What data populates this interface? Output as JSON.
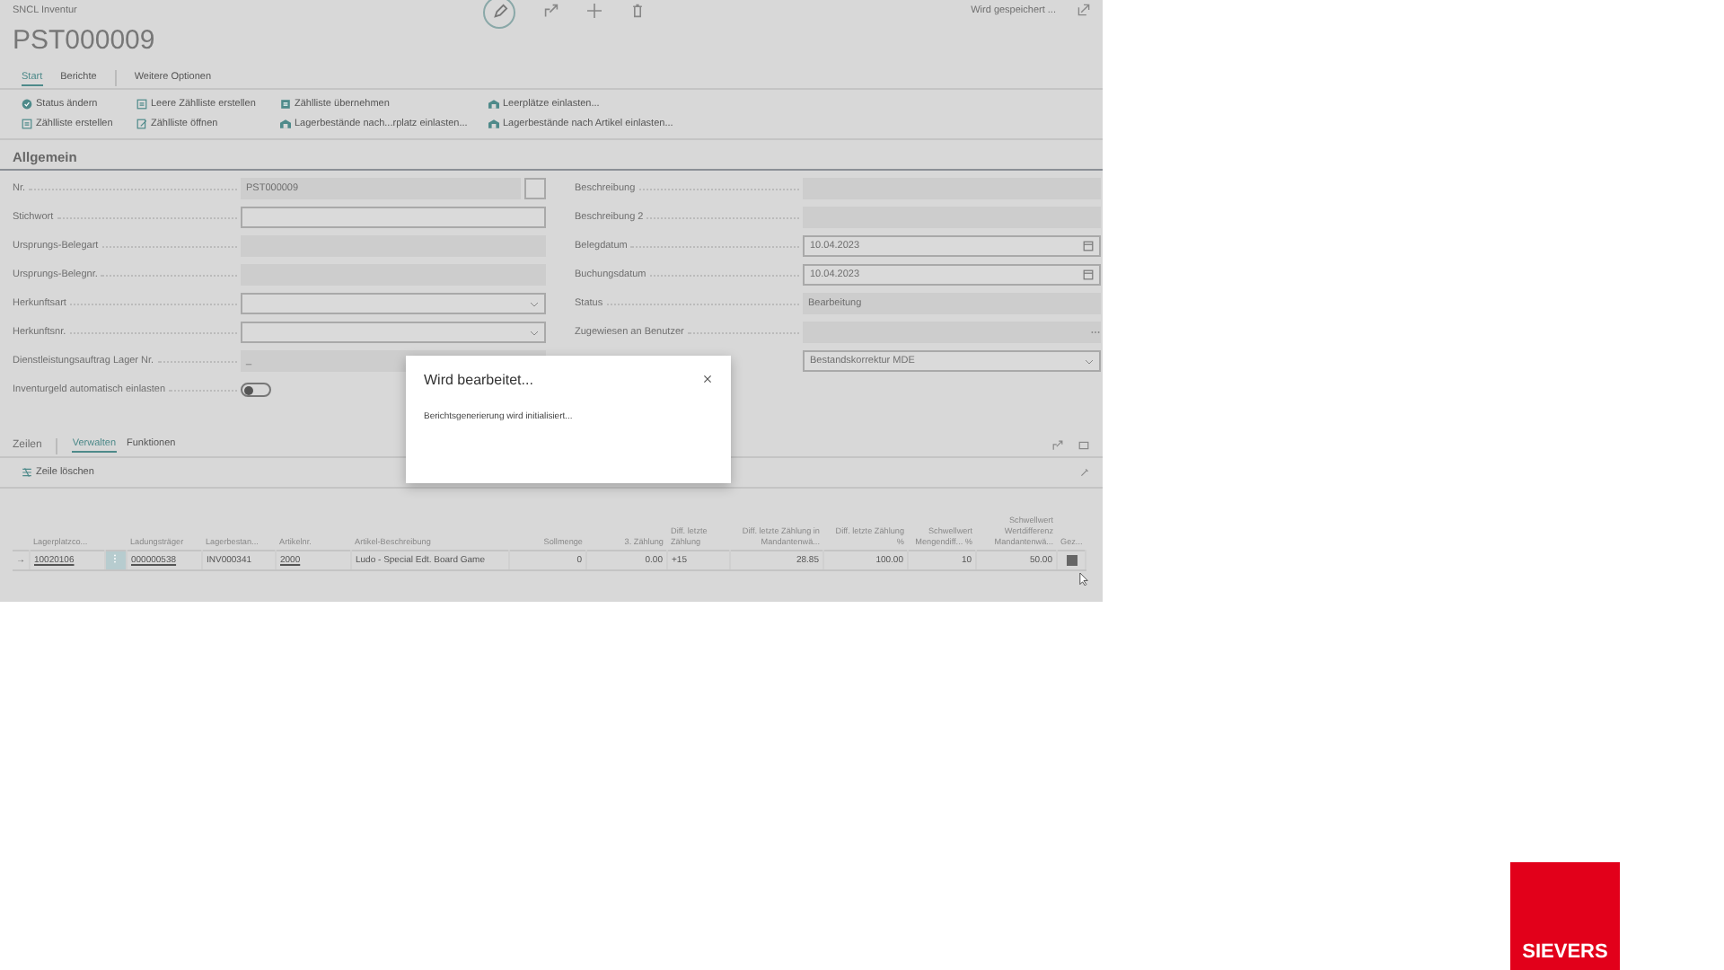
{
  "app": {
    "breadcrumb": "SNCL Inventur",
    "save_status": "Wird gespeichert ...",
    "title": "PST000009",
    "action_tabs": [
      {
        "label": "Start",
        "selected": true
      },
      {
        "label": "Berichte",
        "selected": false
      },
      {
        "label": "Weitere Optionen",
        "selected": false
      }
    ],
    "actions": [
      {
        "label": "Status ändern",
        "kind": "status"
      },
      {
        "label": "Leere Zählliste erstellen",
        "kind": "list"
      },
      {
        "label": "Zählliste übernehmen",
        "kind": "approve"
      },
      {
        "label": "Leerplätze einlasten...",
        "kind": "load"
      },
      {
        "label": "Zählliste erstellen",
        "kind": "list"
      },
      {
        "label": "Zählliste öffnen",
        "kind": "open"
      },
      {
        "label": "Lagerbestände nach...rplatz einlasten...",
        "kind": "load"
      },
      {
        "label": "Lagerbestände nach Artikel einlasten...",
        "kind": "load"
      }
    ],
    "section": "Allgemein",
    "fields_left": [
      {
        "label": "Nr.",
        "kind": "lookup",
        "value": "PST000009"
      },
      {
        "label": "Stichwort",
        "kind": "text"
      },
      {
        "label": "Ursprungs-Belegart",
        "kind": "readonly"
      },
      {
        "label": "Ursprungs-Belegnr.",
        "kind": "readonly"
      },
      {
        "label": "Herkunftsart",
        "kind": "select"
      },
      {
        "label": "Herkunftsnr.",
        "kind": "select"
      },
      {
        "label": "Dienstleistungsauftrag Lager Nr.",
        "kind": "readonly",
        "value": "_"
      },
      {
        "label": "Inventurgeld automatisch einlasten",
        "kind": "toggle",
        "on": false
      }
    ],
    "fields_right": [
      {
        "label": "Beschreibung",
        "kind": "readonly"
      },
      {
        "label": "Beschreibung 2",
        "kind": "readonly"
      },
      {
        "label": "Belegdatum",
        "kind": "date",
        "value": "10.04.2023"
      },
      {
        "label": "Buchungsdatum",
        "kind": "date",
        "value": "10.04.2023"
      },
      {
        "label": "Status",
        "kind": "readonly",
        "value": "Bearbeitung"
      },
      {
        "label": "Zugewiesen an Benutzer",
        "kind": "lookup"
      },
      {
        "kind": "select",
        "value": "Bestandskorrektur MDE"
      }
    ],
    "lines": {
      "title": "Zeilen",
      "tabs": [
        {
          "label": "Verwalten",
          "selected": true
        },
        {
          "label": "Funktionen",
          "selected": false
        }
      ],
      "action": "Zeile löschen",
      "columns": [
        "Lagerplatzco...",
        "Ladungsträger",
        "Lagerbestan...",
        "Artikelnr.",
        "Artikel-Beschreibung",
        "Sollmenge",
        "3. Zählung",
        "Diff. letzte Zählung",
        "Diff. letzte Zählung in Mandantenwä...",
        "Diff. letzte Zählung %",
        "Schwellwert Mengendiff... %",
        "Schwellwert Wertdifferenz Mandantenwä...",
        "Gez..."
      ],
      "rows": [
        {
          "marker": "→",
          "cells": [
            "10020106",
            "000000538",
            "INV000341",
            "2000",
            "Ludo - Special Edt. Board Game",
            "0",
            "0.00",
            "+15",
            "28.85",
            "100.00",
            "10",
            "50.00"
          ],
          "checked": true
        }
      ]
    }
  },
  "dialog": {
    "title": "Wird bearbeitet...",
    "message": "Berichtsgenerierung wird initialisiert..."
  },
  "logo": "SIEVERS"
}
